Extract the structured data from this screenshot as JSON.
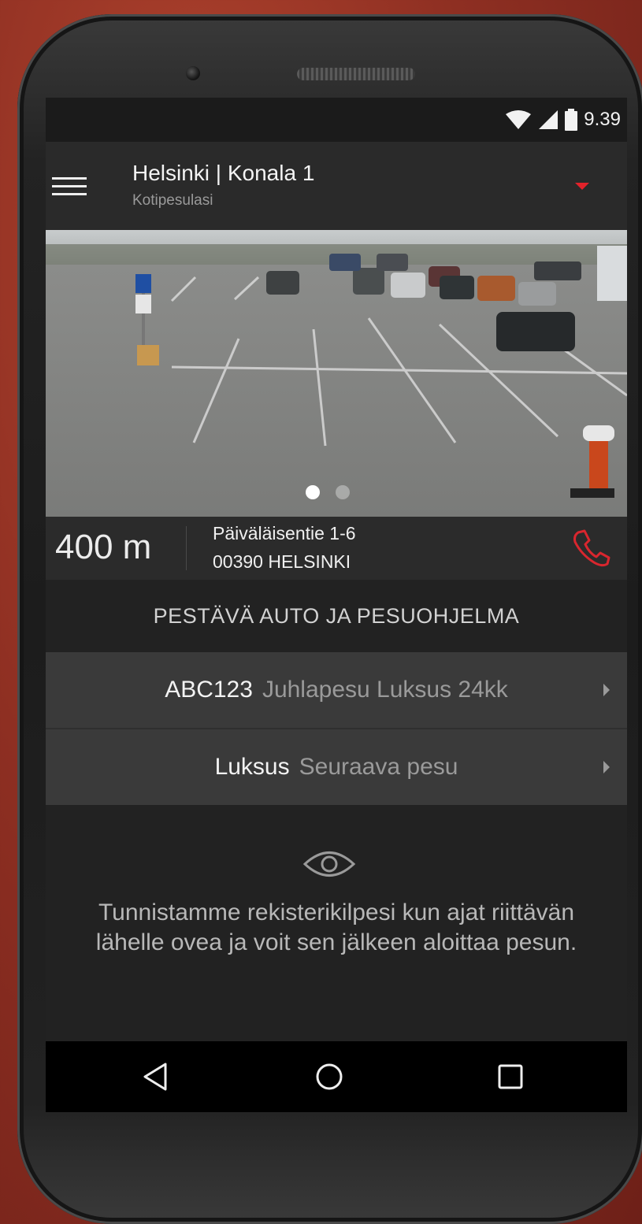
{
  "status_bar": {
    "time": "9.39",
    "icons": [
      "wifi-icon",
      "signal-icon",
      "battery-icon"
    ]
  },
  "app_bar": {
    "title": "Helsinki | Konala 1",
    "subtitle": "Kotipesulasi",
    "menu_icon": "hamburger-menu-icon",
    "dropdown_icon": "dropdown-arrow-icon"
  },
  "photo": {
    "carousel_pages": 2,
    "active_page": 1
  },
  "location": {
    "distance": "400 m",
    "street": "Päiväläisentie 1-6",
    "postal_city": "00390 HELSINKI",
    "call_icon": "phone-icon"
  },
  "section": {
    "title": "PESTÄVÄ AUTO JA PESUOHJELMA"
  },
  "options": [
    {
      "key": "ABC123",
      "value": "Juhlapesu Luksus 24kk"
    },
    {
      "key": "Luksus",
      "value": "Seuraava pesu"
    }
  ],
  "hint": {
    "icon": "eye-icon",
    "text": "Tunnistamme rekisterikilpesi kun ajat riittävän lähelle ovea ja voit sen jälkeen aloittaa pesun."
  },
  "nav_bar": {
    "buttons": [
      "back-icon",
      "home-icon",
      "recents-icon"
    ]
  },
  "colors": {
    "accent_red": "#e2222a",
    "background": "#222222",
    "row_background": "#3a3a3a"
  }
}
